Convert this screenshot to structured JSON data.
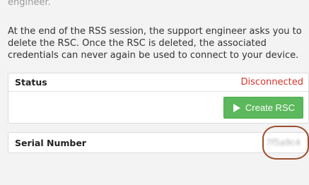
{
  "previous_text": "engineer.",
  "intro": "At the end of the RSS session, the support engineer asks you to delete the RSC. Once the RSC is deleted, the associated credentials can never again be used to connect to your device.",
  "status": {
    "label": "Status",
    "value": "Disconnected",
    "value_color": "#d9342b"
  },
  "create_button": {
    "label": "Create RSC",
    "icon": "play-icon",
    "color": "#5cb85c"
  },
  "serial": {
    "label": "Serial Number",
    "value": "7f5a9c4"
  },
  "annotation": {
    "color": "#9b4d2b"
  }
}
